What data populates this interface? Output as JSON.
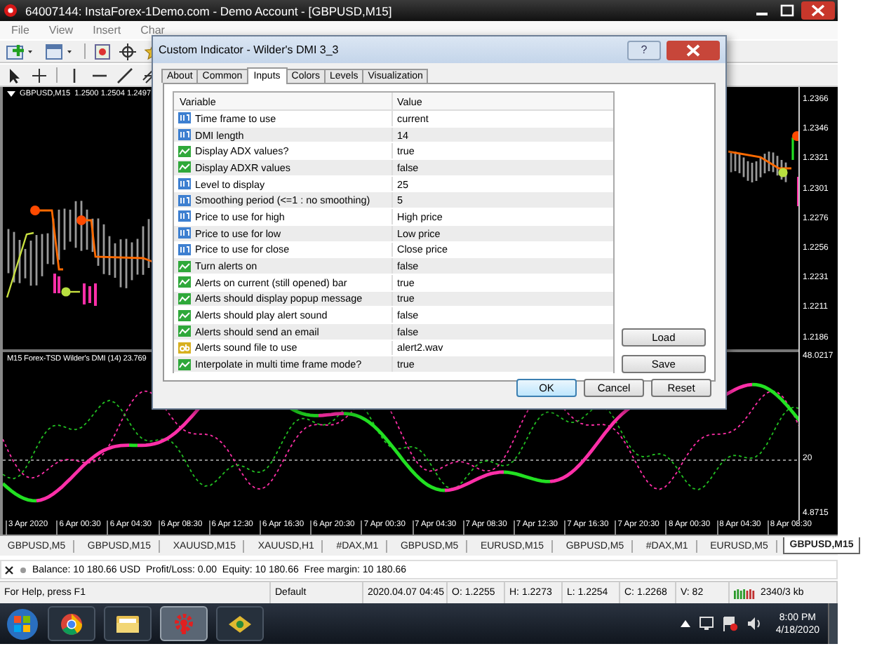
{
  "window": {
    "title": "64007144: InstaForex-1Demo.com - Demo Account - [GBPUSD,M15]",
    "menu": [
      "File",
      "View",
      "Insert",
      "Char"
    ]
  },
  "chart": {
    "symbol_info": "GBPUSD,M15  1.2500 1.2504 1.2497",
    "indicator_info": "M15 Forex-TSD Wilder's DMI (14) 23.769",
    "price_ticks": [
      "1.2366",
      "1.2346",
      "1.2321",
      "1.2301",
      "1.2276",
      "1.2256",
      "1.2231",
      "1.2211",
      "1.2186"
    ],
    "indicator_ticks": [
      "48.0217",
      "20",
      "4.8715"
    ],
    "time_labels": [
      "3 Apr 2020",
      "6 Apr 00:30",
      "6 Apr 04:30",
      "6 Apr 08:30",
      "6 Apr 12:30",
      "6 Apr 16:30",
      "6 Apr 20:30",
      "7 Apr 00:30",
      "7 Apr 04:30",
      "7 Apr 08:30",
      "7 Apr 12:30",
      "7 Apr 16:30",
      "7 Apr 20:30",
      "8 Apr 00:30",
      "8 Apr 04:30",
      "8 Apr 08:30"
    ]
  },
  "chart_tabs": [
    {
      "label": "GBPUSD,M5",
      "selected": false
    },
    {
      "label": "GBPUSD,M15",
      "selected": false
    },
    {
      "label": "XAUUSD,M15",
      "selected": false
    },
    {
      "label": "XAUUSD,H1",
      "selected": false
    },
    {
      "label": "#DAX,M1",
      "selected": false
    },
    {
      "label": "GBPUSD,M5",
      "selected": false
    },
    {
      "label": "EURUSD,M15",
      "selected": false
    },
    {
      "label": "GBPUSD,M5",
      "selected": false
    },
    {
      "label": "#DAX,M1",
      "selected": false
    },
    {
      "label": "EURUSD,M5",
      "selected": false
    },
    {
      "label": "GBPUSD,M15",
      "selected": true
    }
  ],
  "account_line": "Balance: 10 180.66 USD  Profit/Loss: 0.00  Equity: 10 180.66  Free margin: 10 180.66",
  "status_bar": [
    "For Help, press F1",
    "Default",
    "2020.04.07 04:45",
    "O: 1.2255",
    "H: 1.2273",
    "L: 1.2254",
    "C: 1.2268",
    "V: 82",
    "2340/3 kb"
  ],
  "clock": {
    "time": "8:00 PM",
    "date": "4/18/2020"
  },
  "dialog": {
    "title": "Custom Indicator - Wilder's DMI 3_3",
    "help_button": "?",
    "tabs": [
      {
        "label": "About",
        "selected": false
      },
      {
        "label": "Common",
        "selected": false
      },
      {
        "label": "Inputs",
        "selected": true
      },
      {
        "label": "Colors",
        "selected": false
      },
      {
        "label": "Levels",
        "selected": false
      },
      {
        "label": "Visualization",
        "selected": false
      }
    ],
    "columns": [
      "Variable",
      "Value"
    ],
    "rows": [
      {
        "kind": "number",
        "variable": "Time frame to use",
        "value": "current"
      },
      {
        "kind": "number",
        "variable": "DMI length",
        "value": "14"
      },
      {
        "kind": "bool",
        "variable": "Display ADX values?",
        "value": "true"
      },
      {
        "kind": "bool",
        "variable": "Display ADXR values",
        "value": "false"
      },
      {
        "kind": "number",
        "variable": "Level to display",
        "value": "25"
      },
      {
        "kind": "number",
        "variable": "Smoothing period (<=1 : no smoothing)",
        "value": "5"
      },
      {
        "kind": "number",
        "variable": "Price to use for high",
        "value": "High price"
      },
      {
        "kind": "number",
        "variable": "Price to use for low",
        "value": "Low price"
      },
      {
        "kind": "number",
        "variable": "Price to use for close",
        "value": "Close price"
      },
      {
        "kind": "bool",
        "variable": "Turn alerts on",
        "value": "false"
      },
      {
        "kind": "bool",
        "variable": "Alerts on current (still opened) bar",
        "value": "true"
      },
      {
        "kind": "bool",
        "variable": "Alerts should display popup message",
        "value": "true"
      },
      {
        "kind": "bool",
        "variable": "Alerts should play alert sound",
        "value": "false"
      },
      {
        "kind": "bool",
        "variable": "Alerts should send an email",
        "value": "false"
      },
      {
        "kind": "string",
        "variable": "Alerts sound file to use",
        "value": "alert2.wav"
      },
      {
        "kind": "bool",
        "variable": "Interpolate in multi time frame mode?",
        "value": "true"
      }
    ],
    "side_buttons": [
      "Load",
      "Save"
    ],
    "buttons": [
      {
        "label": "OK",
        "default": true
      },
      {
        "label": "Cancel",
        "default": false
      },
      {
        "label": "Reset",
        "default": false
      }
    ]
  }
}
